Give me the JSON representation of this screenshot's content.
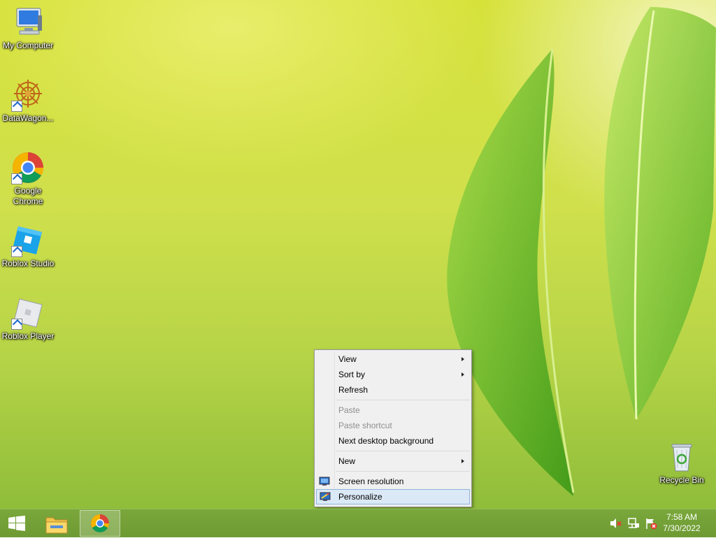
{
  "desktop": {
    "icons": [
      {
        "label": "My Computer",
        "icon": "computer-icon",
        "shortcut": false
      },
      {
        "label": "DataWagon...",
        "icon": "datawagon-icon",
        "shortcut": true
      },
      {
        "label": "Google Chrome",
        "icon": "chrome-icon",
        "shortcut": true
      },
      {
        "label": "Roblox Studio",
        "icon": "roblox-studio-icon",
        "shortcut": true
      },
      {
        "label": "Roblox Player",
        "icon": "roblox-player-icon",
        "shortcut": true
      }
    ],
    "recycle_bin": {
      "label": "Recycle Bin",
      "icon": "recycle-bin-icon"
    }
  },
  "context_menu": {
    "view": "View",
    "sort_by": "Sort by",
    "refresh": "Refresh",
    "paste": "Paste",
    "paste_shortcut": "Paste shortcut",
    "next_background": "Next desktop background",
    "new": "New",
    "screen_resolution": "Screen resolution",
    "personalize": "Personalize",
    "highlighted": "Personalize"
  },
  "taskbar": {
    "start": "windows-logo-icon",
    "pinned": [
      "file-explorer-icon",
      "chrome-icon"
    ],
    "active": "chrome-icon",
    "tray_icons": [
      "volume-muted-icon",
      "network-icon",
      "action-center-flag-icon"
    ],
    "time": "7:58 AM",
    "date": "7/30/2022"
  },
  "colors": {
    "taskbar": "#6d9a32",
    "menu_background": "#f0f0f0",
    "menu_highlight": "#dbe9f6"
  }
}
